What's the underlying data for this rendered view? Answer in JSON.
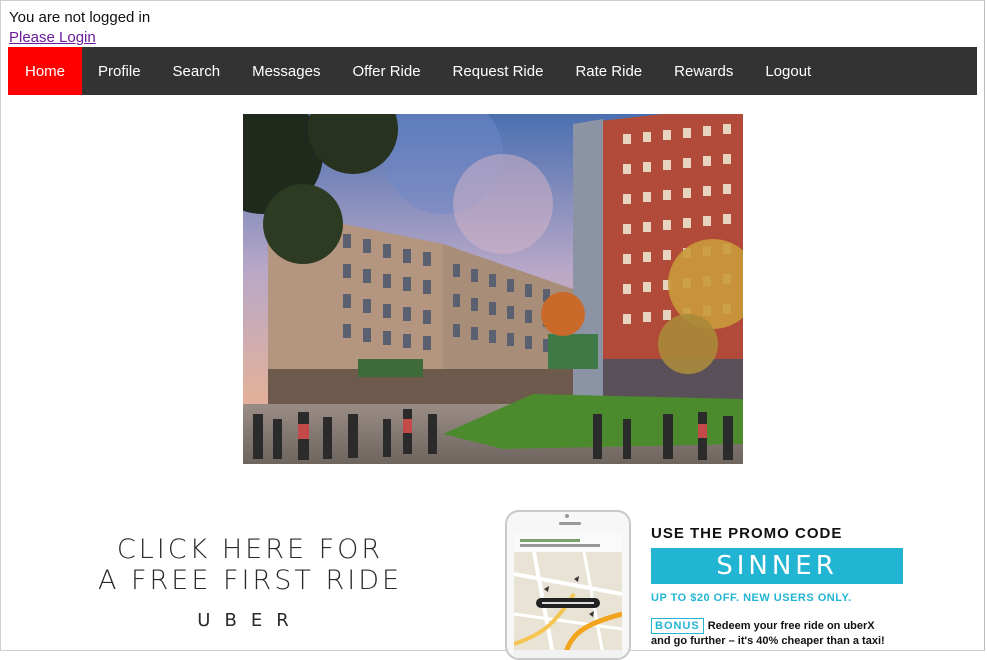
{
  "status": {
    "message": "You are not logged in",
    "login_link": "Please Login"
  },
  "nav": {
    "items": [
      {
        "label": "Home",
        "active": true
      },
      {
        "label": "Profile"
      },
      {
        "label": "Search"
      },
      {
        "label": "Messages"
      },
      {
        "label": "Offer Ride"
      },
      {
        "label": "Request Ride"
      },
      {
        "label": "Rate Ride"
      },
      {
        "label": "Rewards"
      },
      {
        "label": "Logout"
      }
    ],
    "bg_color": "#333333",
    "active_color": "#ff0000"
  },
  "hero_image": {
    "icon": "building-rendering-image"
  },
  "promo": {
    "line1": "CLICK HERE FOR",
    "line2": "A FREE FIRST RIDE",
    "brand": "UBER",
    "code_heading": "USE THE PROMO CODE",
    "code": "SINNER",
    "offer": "UP TO $20 OFF. NEW USERS ONLY.",
    "bonus_tag": "BONUS",
    "bonus_text_1": "Redeem your free ride on uberX",
    "bonus_text_2": "and go further – it's 40% cheaper than a taxi!",
    "accent_color": "#22b5d3"
  }
}
